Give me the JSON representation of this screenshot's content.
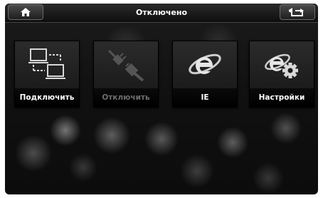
{
  "header": {
    "title": "Отключено",
    "home_icon": "home-icon",
    "back_icon": "back-arrow-icon"
  },
  "tiles": [
    {
      "label": "Подключить",
      "icon": "network-computers-icon",
      "enabled": true
    },
    {
      "label": "Отключить",
      "icon": "unplugged-cable-icon",
      "enabled": false
    },
    {
      "label": "IE",
      "icon": "internet-explorer-icon",
      "enabled": true
    },
    {
      "label": "Настройки",
      "icon": "ie-settings-gear-icon",
      "enabled": true
    }
  ],
  "colors": {
    "text": "#ffffff",
    "disabled_text": "#6e6e6e",
    "background": "#111111"
  }
}
